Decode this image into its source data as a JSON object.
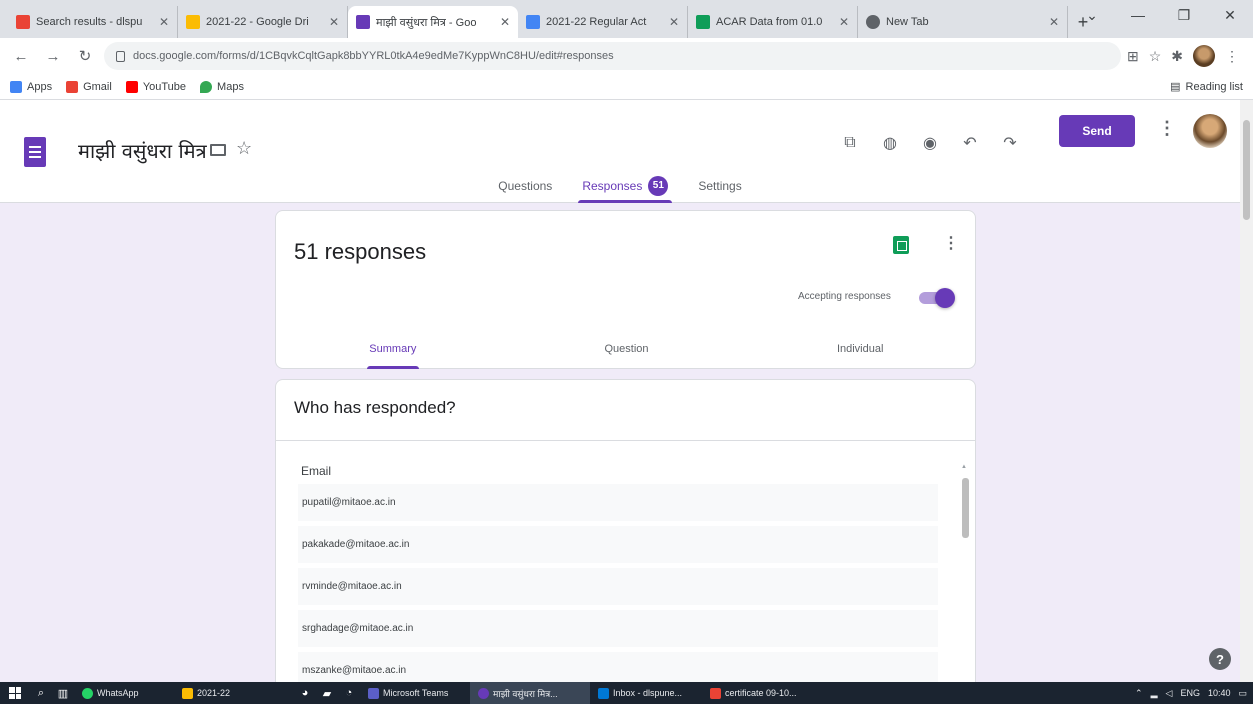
{
  "browser": {
    "tabs": [
      {
        "title": "Search results - dlspu",
        "color": "#ea4335"
      },
      {
        "title": "2021-22 - Google Dri",
        "color": "#fbbc04"
      },
      {
        "title": "माझी वसुंधरा मित्र - Goo",
        "color": "#673ab7",
        "active": true
      },
      {
        "title": "2021-22 Regular Act",
        "color": "#4285f4"
      },
      {
        "title": "ACAR Data from 01.0",
        "color": "#0f9d58"
      },
      {
        "title": "New Tab",
        "color": "#5f6368"
      }
    ],
    "new_tab_symbol": "+",
    "url": "docs.google.com/forms/d/1CBqvkCqltGapk8bbYYRL0tkA4e9edMe7KyppWnC8HU/edit#responses",
    "bookmarks": [
      {
        "label": "Apps",
        "color": "#4285f4"
      },
      {
        "label": "Gmail",
        "color": "#ea4335"
      },
      {
        "label": "YouTube",
        "color": "#ff0000"
      },
      {
        "label": "Maps",
        "color": "#34a853"
      }
    ],
    "reading_list": "Reading list"
  },
  "form": {
    "title": "माझी वसुंधरा मित्र",
    "send_label": "Send",
    "nav": {
      "questions": "Questions",
      "responses": "Responses",
      "responses_badge": "51",
      "settings": "Settings"
    }
  },
  "responses": {
    "count_label": "51 responses",
    "accepting_label": "Accepting responses",
    "accepting": true,
    "subtabs": {
      "summary": "Summary",
      "question": "Question",
      "individual": "Individual"
    }
  },
  "who": {
    "title": "Who has responded?",
    "column": "Email",
    "emails": [
      "pupatil@mitaoe.ac.in",
      "pakakade@mitaoe.ac.in",
      "rvminde@mitaoe.ac.in",
      "srghadage@mitaoe.ac.in",
      "mszanke@mitaoe.ac.in"
    ]
  },
  "taskbar": {
    "apps": [
      {
        "label": "WhatsApp",
        "color": "#25d366"
      },
      {
        "label": "2021-22",
        "color": "#fbbc04"
      },
      {
        "label": "Microsoft Teams",
        "color": "#5b5fc7"
      },
      {
        "label": "माझी वसुंधरा मित्र...",
        "color": "#673ab7",
        "active": true
      },
      {
        "label": "Inbox - dlspune...",
        "color": "#0078d4"
      },
      {
        "label": "certificate 09-10...",
        "color": "#ea4335"
      }
    ],
    "lang": "ENG",
    "time": "10:40"
  }
}
